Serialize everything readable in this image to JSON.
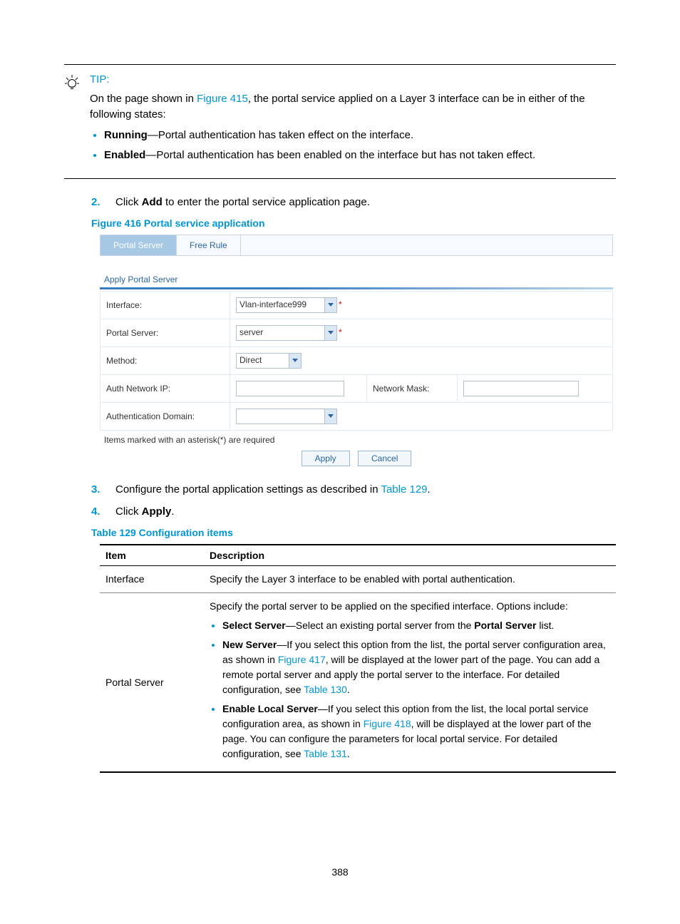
{
  "tip": {
    "label": "TIP:",
    "intro_pre": "On the page shown in ",
    "intro_link": "Figure 415",
    "intro_post": ", the portal service applied on a Layer 3 interface can be in either of the following states:",
    "b1_term": "Running",
    "b1_rest": "—Portal authentication has taken effect on the interface.",
    "b2_term": "Enabled",
    "b2_rest": "—Portal authentication has been enabled on the interface but has not taken effect."
  },
  "steps": {
    "s2_num": "2.",
    "s2_pre": "Click ",
    "s2_bold": "Add",
    "s2_post": " to enter the portal service application page.",
    "s3_num": "3.",
    "s3_pre": "Configure the portal application settings as described in ",
    "s3_link": "Table 129",
    "s3_post": ".",
    "s4_num": "4.",
    "s4_pre": "Click ",
    "s4_bold": "Apply",
    "s4_post": "."
  },
  "figure_caption": "Figure 416 Portal service application",
  "figure": {
    "tab_active": "Portal Server",
    "tab_other": "Free Rule",
    "section": "Apply Portal Server",
    "lbl_interface": "Interface:",
    "val_interface": "Vlan-interface999",
    "lbl_portal": "Portal Server:",
    "val_portal": "server",
    "lbl_method": "Method:",
    "val_method": "Direct",
    "lbl_authip": "Auth Network IP:",
    "lbl_mask": "Network Mask:",
    "lbl_domain": "Authentication Domain:",
    "note": "Items marked with an asterisk(*) are required",
    "btn_apply": "Apply",
    "btn_cancel": "Cancel",
    "req": "*"
  },
  "table_caption": "Table 129 Configuration items",
  "table": {
    "h_item": "Item",
    "h_desc": "Description",
    "r1_item": "Interface",
    "r1_desc": "Specify the Layer 3 interface to be enabled with portal authentication.",
    "r2_item": "Portal Server",
    "r2_intro": "Specify the portal server to be applied on the specified interface. Options include:",
    "r2_b1_term": "Select Server",
    "r2_b1_mid": "—Select an existing portal server from the ",
    "r2_b1_bold": "Portal Server",
    "r2_b1_end": " list.",
    "r2_b2_term": "New Server",
    "r2_b2_pre": "—If you select this option from the list, the portal server configuration area, as shown in ",
    "r2_b2_link1": "Figure 417",
    "r2_b2_mid": ", will be displayed at the lower part of the page. You can add a remote portal server and apply the portal server to the interface. For detailed configuration, see ",
    "r2_b2_link2": "Table 130",
    "r2_b2_end": ".",
    "r2_b3_term": "Enable Local Server",
    "r2_b3_pre": "—If you select this option from the list, the local portal service configuration area, as shown in ",
    "r2_b3_link1": "Figure 418",
    "r2_b3_mid": ", will be displayed at the lower part of the page. You can configure the parameters for local portal service. For detailed configuration, see ",
    "r2_b3_link2": "Table 131",
    "r2_b3_end": "."
  },
  "page_number": "388"
}
